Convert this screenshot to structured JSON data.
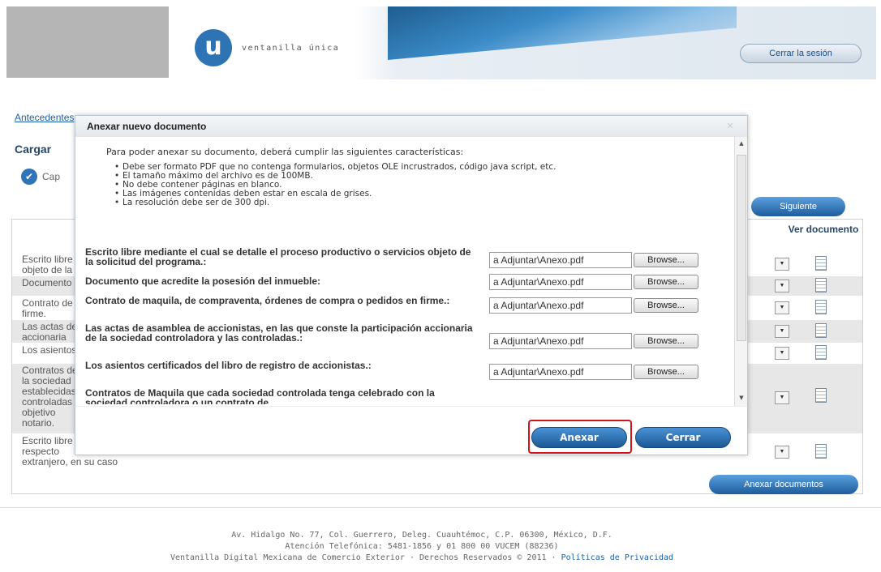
{
  "header": {
    "logo_letter": "u",
    "logo_text": "ventanilla única",
    "logout_label": "Cerrar la sesión"
  },
  "page": {
    "breadcrumb": "Antecedentes",
    "title": "Cargar",
    "step_label": "Cap",
    "next_label": "Siguiente",
    "ver_documento": "Ver documento",
    "attach_docs_label": "Anexar documentos",
    "rows": [
      {
        "text": "Escrito libre mediante el cual\nobjeto de la solicitud",
        "alt": false
      },
      {
        "text": "Documento que acredite",
        "alt": true
      },
      {
        "text": "Contrato de maquila\nfirme.",
        "alt": false
      },
      {
        "text": "Las actas de asamblea\naccionaria",
        "alt": true
      },
      {
        "text": "Los asientos",
        "alt": false
      },
      {
        "text": "Contratos de Maquila\nla sociedad\nestablecidas\ncontroladas\nobjetivo\nnotario.",
        "alt": true
      },
      {
        "text": "Escrito libre\nrespecto\nextranjero, en su caso",
        "alt": false
      }
    ]
  },
  "modal": {
    "title": "Anexar nuevo documento",
    "intro": "Para poder anexar su documento, deberá cumplir las siguientes características:",
    "requirements": [
      "Debe ser formato PDF que no contenga formularios, objetos OLE incrustrados, código java script, etc.",
      "El tamaño máximo del archivo es de 100MB.",
      "No debe contener páginas en blanco.",
      "Las imágenes contenidas deben estar en escala de grises.",
      "La resolución debe ser de 300 dpi."
    ],
    "fields": [
      {
        "label": "Escrito libre mediante el cual se detalle el proceso productivo o servicios objeto de la solicitud del programa.:",
        "value": "a Adjuntar\\Anexo.pdf",
        "browse": "Browse..."
      },
      {
        "label": "Documento que acredite la posesión del inmueble:",
        "value": "a Adjuntar\\Anexo.pdf",
        "browse": "Browse..."
      },
      {
        "label": "Contrato de maquila, de compraventa, órdenes de compra o pedidos en firme.:",
        "value": "a Adjuntar\\Anexo.pdf",
        "browse": "Browse..."
      },
      {
        "label": "Las actas de asamblea de accionistas, en las que conste la participación accionaria de la sociedad controladora y las controladas.:",
        "value": "a Adjuntar\\Anexo.pdf",
        "browse": "Browse..."
      },
      {
        "label": "Los asientos certificados del libro de registro de accionistas.:",
        "value": "a Adjuntar\\Anexo.pdf",
        "browse": "Browse..."
      },
      {
        "label": "Contratos de Maquila que cada sociedad controlada tenga celebrado con la sociedad controladora o un contrato de",
        "value": "",
        "browse": ""
      }
    ],
    "annex_label": "Anexar",
    "close_label": "Cerrar"
  },
  "footer": {
    "line1": "Av. Hidalgo No. 77, Col. Guerrero, Deleg. Cuauhtémoc, C.P. 06300, México, D.F.",
    "line2": "Atención Telefónica: 5481-1856 y 01 800 00 VUCEM (88236)",
    "line3": "Ventanilla Digital Mexicana de Comercio Exterior · Derechos Reservados © 2011 · ",
    "privacy": "Políticas de Privacidad"
  },
  "colors": {
    "accent": "#2e74b5",
    "button": "#1e5c9c",
    "highlight": "#d4141d"
  }
}
